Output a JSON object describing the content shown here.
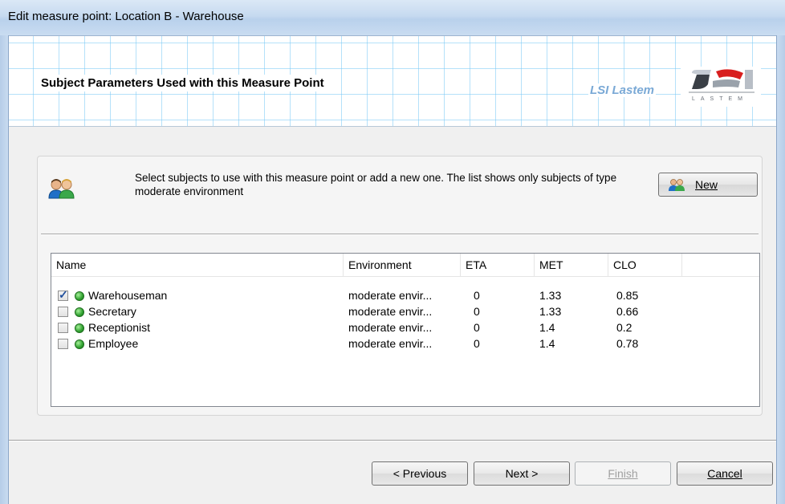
{
  "window": {
    "title": "Edit measure point: Location B - Warehouse"
  },
  "banner": {
    "heading": "Subject Parameters Used with this Measure Point",
    "brand": "LSI Lastem"
  },
  "panel": {
    "instructions": "Select subjects to use with this measure point or add a new one. The list shows only subjects of type moderate environment",
    "new_button": "New"
  },
  "list": {
    "columns": [
      "Name",
      "Environment",
      "ETA",
      "MET",
      "CLO"
    ],
    "rows": [
      {
        "checked": true,
        "name": "Warehouseman",
        "environment": "moderate envir...",
        "eta": "0",
        "met": "1.33",
        "clo": "0.85"
      },
      {
        "checked": false,
        "name": "Secretary",
        "environment": "moderate envir...",
        "eta": "0",
        "met": "1.33",
        "clo": "0.66"
      },
      {
        "checked": false,
        "name": "Receptionist",
        "environment": "moderate envir...",
        "eta": "0",
        "met": "1.4",
        "clo": "0.2"
      },
      {
        "checked": false,
        "name": "Employee",
        "environment": "moderate envir...",
        "eta": "0",
        "met": "1.4",
        "clo": "0.78"
      }
    ]
  },
  "buttons": {
    "previous": "< Previous",
    "next": "Next >",
    "finish": "Finish",
    "cancel": "Cancel"
  },
  "colors": {
    "accent_grid": "#78c8f5",
    "status_dot": "#2fa02f",
    "brand_text": "#7aa9d6"
  }
}
